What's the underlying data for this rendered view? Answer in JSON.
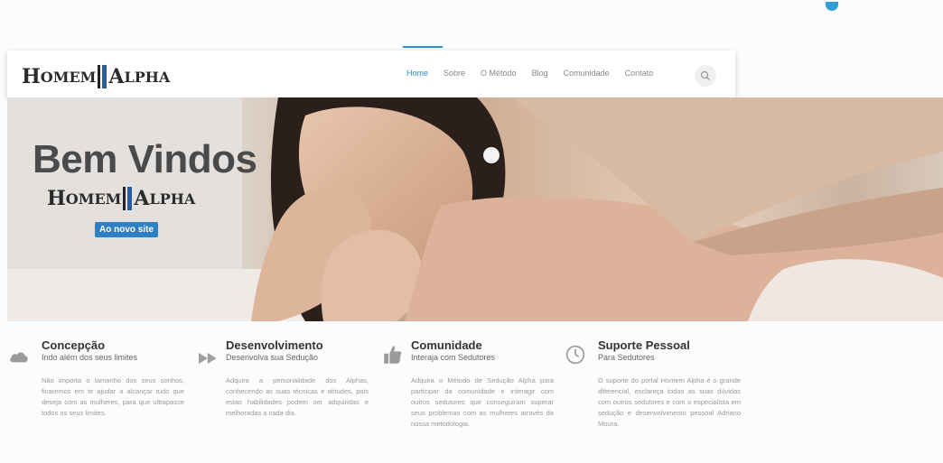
{
  "logo": {
    "word1_big": "H",
    "word1_small": "OMEM",
    "word2_big": "A",
    "word2_small": "LPHA"
  },
  "nav": {
    "items": [
      "Home",
      "Sobre",
      "O Método",
      "Blog",
      "Comunidade",
      "Contato"
    ],
    "active": "Home",
    "search_icon": "search-icon"
  },
  "hero": {
    "title": "Bem Vindos",
    "badge": "Ao novo site"
  },
  "features": [
    {
      "icon": "cloud-icon",
      "title": "Concepção",
      "subtitle": "Indo além dos seus limites",
      "body": "Não importa o tamanho dos seus sonhos, ficaremos em te ajudar a alcançar tudo que deseja com as mulheres, para que ultrapasse todos os seus limites."
    },
    {
      "icon": "fast-forward-icon",
      "title": "Desenvolvimento",
      "subtitle": "Desenvolva sua Sedução",
      "body": "Adquira a personalidade dos Alphas, conhecendo as suas técnicas e atitudes, pois estas habilidades podem ser adquiridas e melhoradas a cada dia."
    },
    {
      "icon": "thumbs-up-icon",
      "title": "Comunidade",
      "subtitle": "Interaja com Sedutores",
      "body": "Adquira o Método de Sedução Alpha para participar da comunidade e interagir com outros sedutores que conseguiram superar seus problemas com as mulheres através da nossa metodologia."
    },
    {
      "icon": "clock-icon",
      "title": "Suporte Pessoal",
      "subtitle": "Para Sedutores",
      "body": "O suporte do portal Homem Alpha é o grande diferencial, esclareça todas as suas dúvidas com outros sedutores e com o especialista em sedução e desenvolvimento pessoal Adriano Moura."
    }
  ],
  "colors": {
    "accent": "#2a8fd0",
    "badge": "#2f7fc4",
    "logo_bar": "#2a5d9e"
  }
}
